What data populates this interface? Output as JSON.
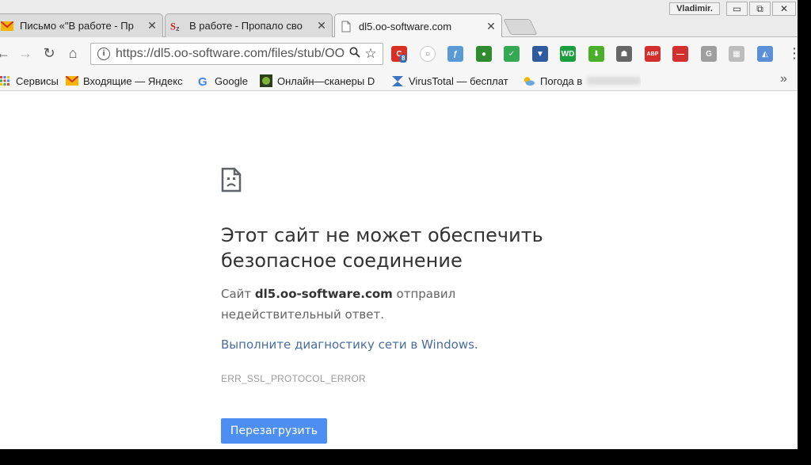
{
  "window": {
    "profile_name": "Vladimir.",
    "minimize": "▭",
    "restore": "⧉",
    "close": "✕"
  },
  "tabs": [
    {
      "title": "Письмо «\"В работе - Пр",
      "icon": "yandex-mail-icon",
      "active": false
    },
    {
      "title": "В работе - Пропало сво",
      "icon": "sz-forum-icon",
      "active": false
    },
    {
      "title": "dl5.oo-software.com",
      "icon": "page-icon",
      "active": true
    }
  ],
  "tab_close": "✕",
  "toolbar": {
    "back": "←",
    "forward": "→",
    "reload": "↻",
    "home": "⌂",
    "url": "https://dl5.oo-software.com/files/stub/OO",
    "search_glyph": "🔍",
    "star_glyph": "☆",
    "extensions": [
      {
        "name": "counter-extension-icon",
        "label": "C",
        "badge": "8",
        "color": "#d93025"
      },
      {
        "name": "magnifier-extension-icon",
        "label": "○",
        "color": "#ffffff"
      },
      {
        "name": "stylus-extension-icon",
        "label": "ƒ",
        "color": "#5a9bd5"
      },
      {
        "name": "frog-extension-icon",
        "label": "●",
        "color": "#2e8b2e"
      },
      {
        "name": "shield-check-extension-icon",
        "label": "✓",
        "color": "#34a853"
      },
      {
        "name": "shield-extension-icon",
        "label": "▼",
        "color": "#2f5a9e"
      },
      {
        "name": "wd-extension-icon",
        "label": "WD",
        "color": "#1b9e3e"
      },
      {
        "name": "download-arrow-extension-icon",
        "label": "⬇",
        "color": "#4caf2a"
      },
      {
        "name": "ghost-extension-icon",
        "label": "☗",
        "color": "#666666"
      },
      {
        "name": "abp-extension-icon",
        "label": "ABP",
        "color": "#d32f2f"
      },
      {
        "name": "stop-extension-icon",
        "label": "—",
        "color": "#d32f2f"
      },
      {
        "name": "g-extension-icon",
        "label": "G",
        "color": "#9e9e9e"
      },
      {
        "name": "grid-extension-icon",
        "label": "▦",
        "color": "#bdbdbd"
      },
      {
        "name": "drop-extension-icon",
        "label": "◭",
        "color": "#5b8fd6"
      }
    ],
    "menu": "⋮"
  },
  "bookmarks": [
    {
      "label": "Сервисы",
      "icon": "apps-grid-icon"
    },
    {
      "label": "Входящие — Яндекс",
      "icon": "yandex-mail-icon"
    },
    {
      "label": "Google",
      "icon": "google-icon"
    },
    {
      "label": "Онлайн—сканеры D",
      "icon": "scanner-icon"
    },
    {
      "label": "VirusTotal — бесплат",
      "icon": "virustotal-icon"
    },
    {
      "label": "Погода в",
      "icon": "weather-icon"
    }
  ],
  "bookmarks_more": "»",
  "error": {
    "heading": "Этот сайт не может обеспечить безопасное соединение",
    "desc_prefix": "Сайт ",
    "desc_domain": "dl5.oo-software.com",
    "desc_suffix": " отправил недействительный ответ.",
    "diagnostics_link": "Выполните диагностику сети в Windows.",
    "error_code": "ERR_SSL_PROTOCOL_ERROR",
    "reload_button": "Перезагрузить"
  }
}
